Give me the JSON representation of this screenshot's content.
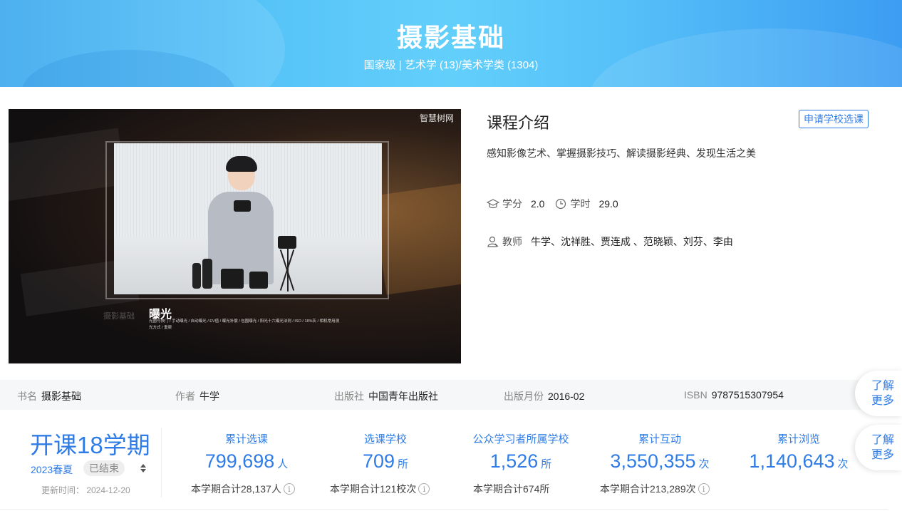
{
  "banner": {
    "title": "摄影基础",
    "subtitle": "国家级 | 艺术学 (13)/美术学类 (1304)"
  },
  "video": {
    "watermark": "智慧树网",
    "caption_ghost": "摄影基础",
    "caption_title": "曝光",
    "caption_detail": "光圈与快门 / 手动曝光 / 自动曝光 / EV值 / 曝光补偿 / 包围曝光 / 阳光十六曝光法则 / ISO / 18%灰 / 相机常用测光方式 / 重渠"
  },
  "intro": {
    "title": "课程介绍",
    "apply_button": "申请学校选课",
    "description": "感知影像艺术、掌握摄影技巧、解读摄影经典、发现生活之美",
    "credit_label": "学分",
    "credit_value": "2.0",
    "hours_label": "学时",
    "hours_value": "29.0",
    "teacher_label": "教师",
    "teacher_value": "牛学、沈祥胜、贾连成 、范晓颖、刘芬、李由"
  },
  "book": {
    "name_label": "书名",
    "name_value": "摄影基础",
    "author_label": "作者",
    "author_value": "牛学",
    "publisher_label": "出版社",
    "publisher_value": "中国青年出版社",
    "date_label": "出版月份",
    "date_value": "2016-02",
    "isbn_label": "ISBN",
    "isbn_value": "9787515307954"
  },
  "float_buttons": [
    {
      "line1": "了解",
      "line2": "更多"
    },
    {
      "line1": "了解",
      "line2": "更多"
    }
  ],
  "term": {
    "headline": "开课18学期",
    "season": "2023春夏",
    "status": "已结束",
    "update_time": "更新时间： 2024-12-20"
  },
  "stats": [
    {
      "label": "累计选课",
      "value": "799,698",
      "unit": "人",
      "footer": "本学期合计28,137人",
      "has_info": true
    },
    {
      "label": "选课学校",
      "value": "709",
      "unit": "所",
      "footer": "本学期合计121校次",
      "has_info": true
    },
    {
      "label": "公众学习者所属学校",
      "value": "1,526",
      "unit": "所",
      "footer": "本学期合计674所",
      "has_info": false
    },
    {
      "label": "累计互动",
      "value": "3,550,355",
      "unit": "次",
      "footer": "本学期合计213,289次",
      "has_info": true
    },
    {
      "label": "累计浏览",
      "value": "1,140,643",
      "unit": "次",
      "footer": "",
      "has_info": false
    }
  ],
  "colors": {
    "accent": "#2f7ce6",
    "banner_start": "#3aa8ee",
    "banner_end": "#3c9df2"
  },
  "icons": {
    "credit": "graduation-cap-icon",
    "hours": "clock-icon",
    "teacher": "user-icon",
    "toggle": "sort-arrows-icon",
    "info": "info-icon"
  }
}
